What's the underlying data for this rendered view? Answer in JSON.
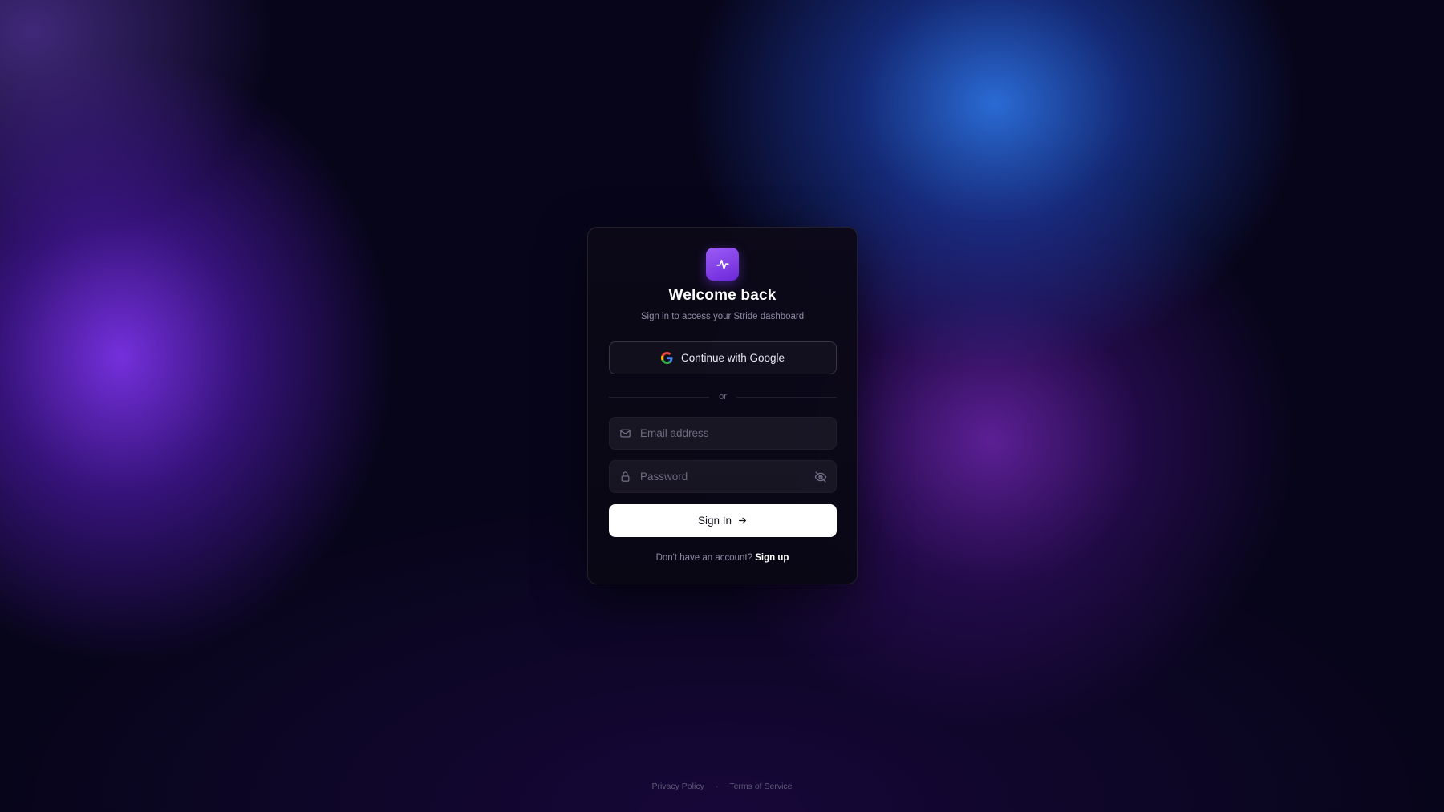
{
  "app": {
    "title": "Welcome back",
    "subtitle": "Sign in to access your Stride dashboard",
    "logo_icon": "activity-pulse-icon"
  },
  "oauth": {
    "google_label": "Continue with Google",
    "google_icon": "google-icon"
  },
  "divider": {
    "label": "or"
  },
  "form": {
    "email_placeholder": "Email address",
    "email_value": "",
    "email_icon": "mail-icon",
    "password_placeholder": "Password",
    "password_value": "",
    "password_icon": "lock-icon",
    "visibility_icon": "eye-off-icon",
    "submit_label": "Sign In",
    "submit_icon": "arrow-right-icon"
  },
  "signup": {
    "prompt": "Don't have an account?",
    "link_label": "Sign up"
  },
  "footer": {
    "privacy_label": "Privacy Policy",
    "separator": "·",
    "terms_label": "Terms of Service"
  },
  "colors": {
    "accent": "#7c3aed",
    "background": "#07051a",
    "card": "#0c0918",
    "primary_button": "#ffffff"
  }
}
